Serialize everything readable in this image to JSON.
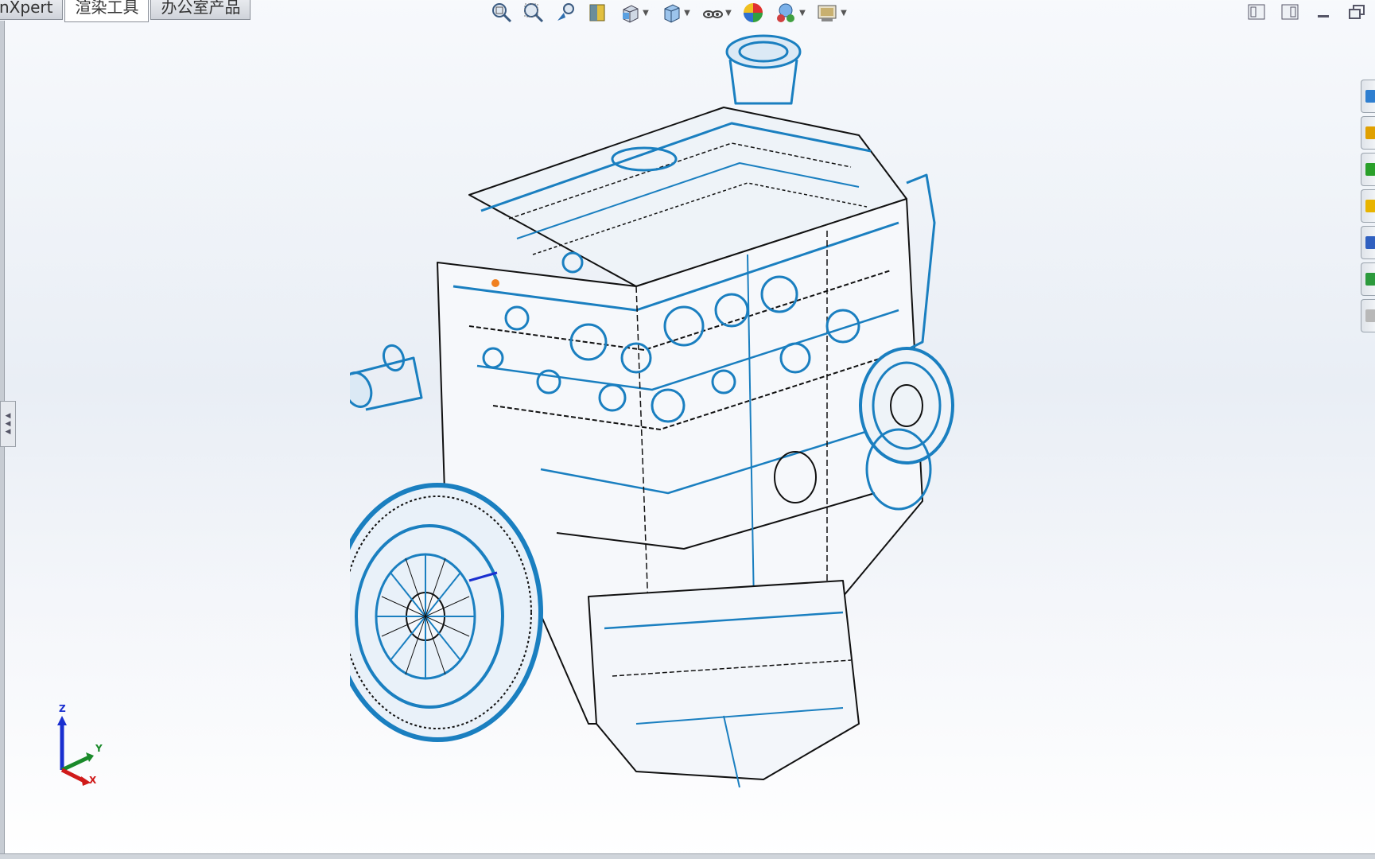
{
  "tabs": [
    {
      "label": "nXpert",
      "active": false
    },
    {
      "label": "渲染工具",
      "active": true
    },
    {
      "label": "办公室产品",
      "active": false
    }
  ],
  "view_toolbar": [
    {
      "icon": "zoom-to-fit-icon"
    },
    {
      "icon": "zoom-to-area-icon"
    },
    {
      "icon": "previous-view-icon"
    },
    {
      "icon": "section-view-icon"
    },
    {
      "icon": "view-orientation-icon",
      "dropdown": true
    },
    {
      "icon": "display-style-icon",
      "dropdown": true
    },
    {
      "icon": "hide-show-items-icon",
      "dropdown": true
    },
    {
      "icon": "edit-appearance-icon"
    },
    {
      "icon": "apply-scene-icon",
      "dropdown": true
    },
    {
      "icon": "view-settings-icon",
      "dropdown": true
    }
  ],
  "window_controls": [
    {
      "icon": "tile-left-icon"
    },
    {
      "icon": "tile-right-icon"
    },
    {
      "icon": "minimize-icon"
    },
    {
      "icon": "restore-icon"
    }
  ],
  "task_pane": [
    {
      "icon": "resources-icon",
      "color": "#2f7fd0"
    },
    {
      "icon": "home-icon",
      "color": "#e0a000"
    },
    {
      "icon": "design-library-icon",
      "color": "#2aa02a"
    },
    {
      "icon": "file-explorer-icon",
      "color": "#e8b400"
    },
    {
      "icon": "view-palette-icon",
      "color": "#3060c0"
    },
    {
      "icon": "appearances-icon",
      "color": "#2c9a3c"
    },
    {
      "icon": "custom-properties-icon",
      "color": "#b8b8b8"
    }
  ],
  "triad": {
    "z": "Z",
    "y": "Y",
    "x": "X",
    "colors": {
      "z": "#1a2fd0",
      "y": "#1a8a2a",
      "x": "#d01a1a"
    }
  },
  "model": {
    "name": "engine-assembly",
    "edge_color": "#1a7fc0"
  }
}
